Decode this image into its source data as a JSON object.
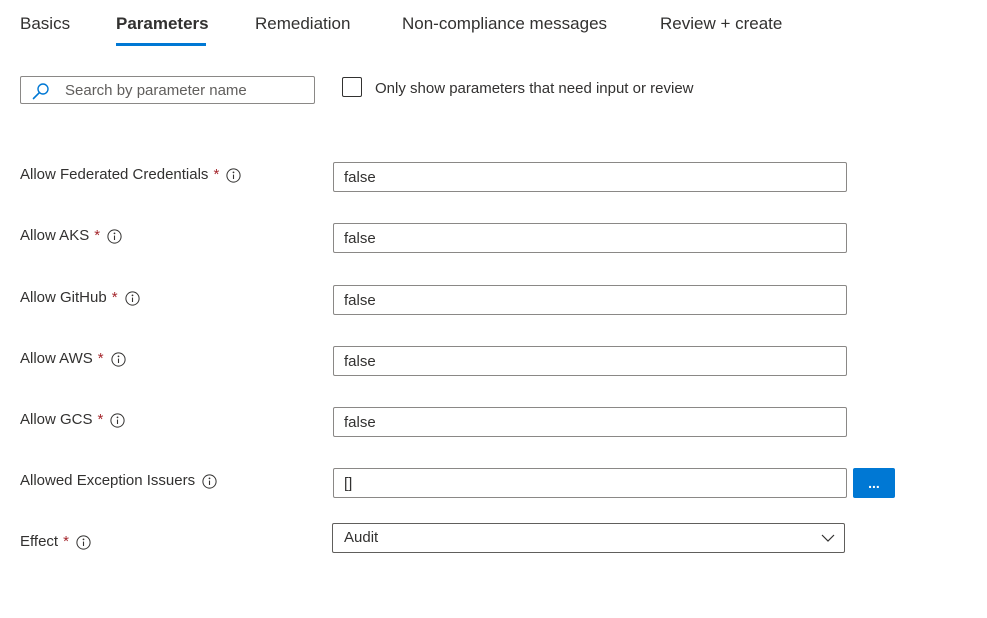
{
  "tabs": [
    {
      "label": "Basics",
      "active": false
    },
    {
      "label": "Parameters",
      "active": true
    },
    {
      "label": "Remediation",
      "active": false
    },
    {
      "label": "Non-compliance messages",
      "active": false
    },
    {
      "label": "Review + create",
      "active": false
    }
  ],
  "search": {
    "placeholder": "Search by parameter name",
    "value": ""
  },
  "filter_checkbox": {
    "label": "Only show parameters that need input or review",
    "checked": false
  },
  "parameters": [
    {
      "label": "Allow Federated Credentials",
      "required": "*",
      "value": "false"
    },
    {
      "label": "Allow AKS",
      "required": "*",
      "value": "false"
    },
    {
      "label": "Allow GitHub",
      "required": "*",
      "value": "false"
    },
    {
      "label": "Allow AWS",
      "required": "*",
      "value": "false"
    },
    {
      "label": "Allow GCS",
      "required": "*",
      "value": "false"
    },
    {
      "label": "Allowed Exception Issuers",
      "required": "",
      "value": "[]",
      "button_label": "..."
    },
    {
      "label": "Effect",
      "required": "*",
      "value": "Audit"
    }
  ],
  "colors": {
    "accent": "#0078d4",
    "required": "#a4262c",
    "text": "#323130",
    "border": "#8a8886"
  },
  "icons": {
    "search": "search-icon",
    "info": "info-icon",
    "dropdown": "chevron-down-icon"
  }
}
